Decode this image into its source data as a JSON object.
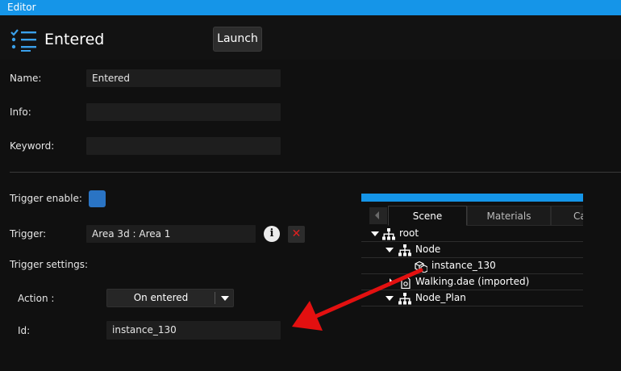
{
  "window": {
    "title": "Editor"
  },
  "header": {
    "icon": "checklist-icon",
    "title": "Entered",
    "launch_label": "Launch"
  },
  "form": {
    "name_label": "Name:",
    "name_value": "Entered",
    "info_label": "Info:",
    "info_value": "",
    "keyword_label": "Keyword:",
    "keyword_value": "",
    "trigger_enable_label": "Trigger enable:",
    "trigger_enable_checked": true,
    "trigger_label": "Trigger:",
    "trigger_value": "Area 3d : Area 1",
    "info_icon_glyph": "i",
    "delete_icon_glyph": "✕",
    "trigger_settings_label": "Trigger settings:",
    "action_label": "Action :",
    "action_value": "On entered",
    "id_label": "Id:",
    "id_value": "instance_130"
  },
  "scene_panel": {
    "tabs": [
      {
        "label": "Scene",
        "active": true
      },
      {
        "label": "Materials",
        "active": false
      },
      {
        "label": "Ca",
        "active": false
      }
    ],
    "tree": [
      {
        "label": "root",
        "icon": "hierarchy-icon",
        "expanded": true
      },
      {
        "label": "Node",
        "icon": "hierarchy-icon",
        "expanded": true
      },
      {
        "label": "instance_130",
        "icon": "cube-instance-icon",
        "expanded": null
      },
      {
        "label": "Walking.dae (imported)",
        "icon": "file-icon",
        "expanded": false
      },
      {
        "label": "Node_Plan",
        "icon": "hierarchy-icon",
        "expanded": true
      }
    ]
  },
  "annotation": {
    "arrow_color": "#e31010"
  },
  "colors": {
    "accent": "#1595e8",
    "checkbox": "#2a74c4",
    "background": "#101010",
    "field": "#1e1e1e"
  }
}
